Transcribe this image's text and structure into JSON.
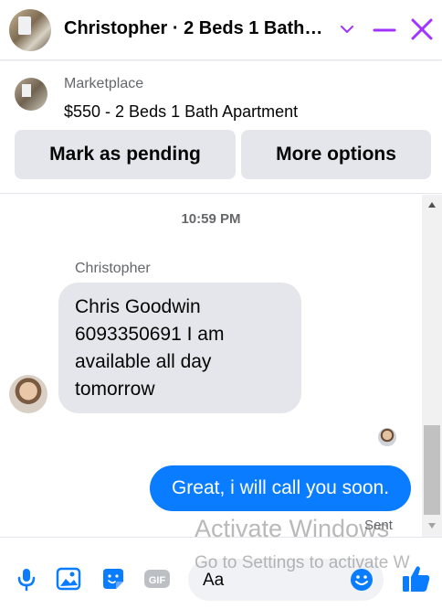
{
  "header": {
    "title": "Christopher · 2 Beds 1 Bath…",
    "accent_color": "#a033ff"
  },
  "listing": {
    "label": "Marketplace",
    "title": "$550 - 2 Beds 1 Bath Apartment",
    "mark_pending_label": "Mark as pending",
    "more_options_label": "More options"
  },
  "conversation": {
    "timestamp": "10:59 PM",
    "sender_name": "Christopher",
    "incoming_lines": [
      "Chris Goodwin",
      "6093350691 I am",
      "available all day",
      "tomorrow"
    ],
    "outgoing_message": "Great, i will call you soon.",
    "status": "Sent"
  },
  "composer": {
    "placeholder": "Aa",
    "gif_label": "GIF",
    "accent_color": "#0a7cff"
  },
  "watermark": {
    "line1": "Activate Windows",
    "line2": "Go to Settings to activate W"
  }
}
